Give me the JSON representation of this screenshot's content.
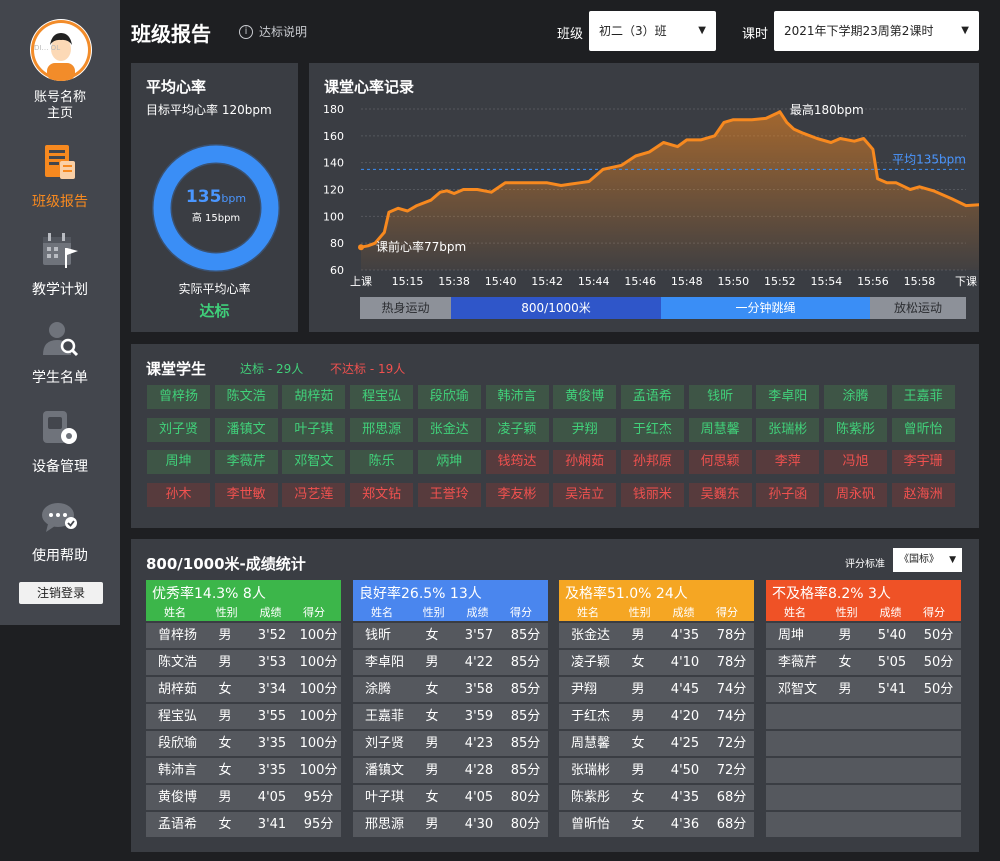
{
  "sidebar": {
    "account_line1": "账号名称",
    "account_line2": "主页",
    "avatar_text": "DI… OL",
    "items": [
      {
        "label": "班级报告",
        "icon": "report-icon",
        "active": true
      },
      {
        "label": "教学计划",
        "icon": "calendar-flag-icon",
        "active": false
      },
      {
        "label": "学生名单",
        "icon": "user-search-icon",
        "active": false
      },
      {
        "label": "设备管理",
        "icon": "device-gear-icon",
        "active": false
      },
      {
        "label": "使用帮助",
        "icon": "chat-help-icon",
        "active": false
      }
    ],
    "logout": "注销登录"
  },
  "header": {
    "title": "班级报告",
    "help_label": "达标说明",
    "class_label": "班级",
    "class_value": "初二（3）班",
    "lesson_label": "课时",
    "lesson_value": "2021年下学期23周第2课时"
  },
  "avg_panel": {
    "title": "平均心率",
    "target_label": "目标平均心率",
    "target_value": "120bpm",
    "value": "135",
    "unit": "bpm",
    "sub": "高 15bpm",
    "actual_label": "实际平均心率",
    "status": "达标",
    "ring_color": "#3a8ef6",
    "status_color": "#3fd07a"
  },
  "chart_panel": {
    "title": "课堂心率记录",
    "max_label": "最高180bpm",
    "avg_label": "平均135bpm",
    "start_label": "课前心率77bpm",
    "phases": [
      {
        "label": "热身运动",
        "bg": "#8d9199",
        "color": "#2b2d31"
      },
      {
        "label": "800/1000米",
        "bg": "#2f56c9",
        "color": "#ffffff"
      },
      {
        "label": "一分钟跳绳",
        "bg": "#3a8ef6",
        "color": "#ffffff"
      },
      {
        "label": "放松运动",
        "bg": "#8d9199",
        "color": "#2b2d31"
      }
    ]
  },
  "chart_data": {
    "type": "area",
    "title": "课堂心率记录",
    "ylim": [
      60,
      180
    ],
    "yticks": [
      60,
      80,
      100,
      120,
      140,
      160,
      180
    ],
    "xticks": [
      "上课",
      "15:15",
      "15:38",
      "15:40",
      "15:42",
      "15:44",
      "15:46",
      "15:48",
      "15:50",
      "15:52",
      "15:54",
      "15:56",
      "15:58",
      "下课"
    ],
    "average": 135,
    "max": 180,
    "start": 77,
    "line_color": "#f7891f",
    "avg_color": "#3a8ef6",
    "series": [
      {
        "values": [
          [
            0,
            77
          ],
          [
            0.15,
            78
          ],
          [
            0.3,
            80
          ],
          [
            0.5,
            88
          ],
          [
            0.6,
            103
          ],
          [
            0.8,
            106
          ],
          [
            1.0,
            104
          ],
          [
            1.2,
            108
          ],
          [
            1.5,
            112
          ],
          [
            1.7,
            118
          ],
          [
            1.85,
            119
          ],
          [
            2.0,
            117
          ],
          [
            2.2,
            120
          ],
          [
            2.5,
            120
          ],
          [
            2.8,
            118
          ],
          [
            3.1,
            125
          ],
          [
            3.5,
            125
          ],
          [
            4.0,
            125
          ],
          [
            4.3,
            123
          ],
          [
            4.5,
            124
          ],
          [
            4.7,
            125
          ],
          [
            4.9,
            126
          ],
          [
            5.2,
            135
          ],
          [
            5.6,
            138
          ],
          [
            5.9,
            145
          ],
          [
            6.2,
            148
          ],
          [
            6.5,
            155
          ],
          [
            6.8,
            152
          ],
          [
            7.0,
            157
          ],
          [
            7.3,
            157
          ],
          [
            7.6,
            160
          ],
          [
            7.8,
            170
          ],
          [
            8.0,
            172
          ],
          [
            8.4,
            172
          ],
          [
            8.7,
            173
          ],
          [
            8.95,
            177
          ],
          [
            9.0,
            178
          ],
          [
            9.15,
            170
          ],
          [
            9.3,
            165
          ],
          [
            9.5,
            162
          ],
          [
            9.8,
            158
          ],
          [
            10.1,
            155
          ],
          [
            10.3,
            158
          ],
          [
            10.6,
            156
          ],
          [
            10.8,
            158
          ],
          [
            11.0,
            150
          ],
          [
            11.1,
            128
          ],
          [
            11.3,
            125
          ],
          [
            11.5,
            125
          ],
          [
            11.8,
            120
          ],
          [
            12.0,
            122
          ],
          [
            12.3,
            119
          ],
          [
            12.7,
            113
          ],
          [
            13.0,
            108
          ],
          [
            13.4,
            109
          ],
          [
            13.7,
            110
          ],
          [
            14.0,
            113
          ],
          [
            14.4,
            118
          ],
          [
            14.8,
            120
          ],
          [
            15.1,
            120
          ],
          [
            15.3,
            118
          ]
        ]
      }
    ]
  },
  "students": {
    "title": "课堂学生",
    "pass_label": "达标 - 29人",
    "fail_label": "不达标 - 19人",
    "pass": [
      "曾梓扬",
      "陈文浩",
      "胡梓茹",
      "程宝弘",
      "段欣瑜",
      "韩沛言",
      "黄俊博",
      "孟语希",
      "钱昕",
      "李卓阳",
      "涂腾",
      "王嘉菲",
      "刘子贤",
      "潘镇文",
      "叶子琪",
      "邢思源",
      "张金达",
      "凌子颖",
      "尹翔",
      "于红杰",
      "周慧馨",
      "张瑞彬",
      "陈紫彤",
      "曾昕怡",
      "周坤",
      "李薇芹",
      "邓智文",
      "陈乐",
      "炳坤"
    ],
    "fail": [
      "钱筠达",
      "孙娴茹",
      "孙邦原",
      "何思颖",
      "李萍",
      "冯旭",
      "李宇珊",
      "孙木",
      "李世敏",
      "冯艺莲",
      "郑文钻",
      "王誉玲",
      "李友彬",
      "吴洁立",
      "钱丽米",
      "吴巍东",
      "孙子函",
      "周永矾",
      "赵海洲"
    ]
  },
  "grades": {
    "title": "800/1000米-成绩统计",
    "standard_label": "评分标准",
    "standard_value": "《国标》",
    "col_name": "姓名",
    "col_gender": "性别",
    "col_score": "成绩",
    "col_points": "得分",
    "cards": [
      {
        "title": "优秀率14.3%  8人",
        "color": "#3cb64a",
        "rows": [
          [
            "曾梓扬",
            "男",
            "3'52",
            "100分"
          ],
          [
            "陈文浩",
            "男",
            "3'53",
            "100分"
          ],
          [
            "胡梓茹",
            "女",
            "3'34",
            "100分"
          ],
          [
            "程宝弘",
            "男",
            "3'55",
            "100分"
          ],
          [
            "段欣瑜",
            "女",
            "3'35",
            "100分"
          ],
          [
            "韩沛言",
            "女",
            "3'35",
            "100分"
          ],
          [
            "黄俊博",
            "男",
            "4'05",
            "95分"
          ],
          [
            "孟语希",
            "女",
            "3'41",
            "95分"
          ]
        ]
      },
      {
        "title": "良好率26.5%  13人",
        "color": "#4a86ee",
        "rows": [
          [
            "钱昕",
            "女",
            "3'57",
            "85分"
          ],
          [
            "李卓阳",
            "男",
            "4'22",
            "85分"
          ],
          [
            "涂腾",
            "女",
            "3'58",
            "85分"
          ],
          [
            "王嘉菲",
            "女",
            "3'59",
            "85分"
          ],
          [
            "刘子贤",
            "男",
            "4'23",
            "85分"
          ],
          [
            "潘镇文",
            "男",
            "4'28",
            "85分"
          ],
          [
            "叶子琪",
            "女",
            "4'05",
            "80分"
          ],
          [
            "邢思源",
            "男",
            "4'30",
            "80分"
          ]
        ]
      },
      {
        "title": "及格率51.0%  24人",
        "color": "#f5a623",
        "rows": [
          [
            "张金达",
            "男",
            "4'35",
            "78分"
          ],
          [
            "凌子颖",
            "女",
            "4'10",
            "78分"
          ],
          [
            "尹翔",
            "男",
            "4'45",
            "74分"
          ],
          [
            "于红杰",
            "男",
            "4'20",
            "74分"
          ],
          [
            "周慧馨",
            "女",
            "4'25",
            "72分"
          ],
          [
            "张瑞彬",
            "男",
            "4'50",
            "72分"
          ],
          [
            "陈紫彤",
            "女",
            "4'35",
            "68分"
          ],
          [
            "曾昕怡",
            "女",
            "4'36",
            "68分"
          ]
        ]
      },
      {
        "title": "不及格率8.2%  3人",
        "color": "#ef5226",
        "rows": [
          [
            "周坤",
            "男",
            "5'40",
            "50分"
          ],
          [
            "李薇芹",
            "女",
            "5'05",
            "50分"
          ],
          [
            "邓智文",
            "男",
            "5'41",
            "50分"
          ],
          [
            "",
            "",
            "",
            ""
          ],
          [
            "",
            "",
            "",
            ""
          ],
          [
            "",
            "",
            "",
            ""
          ],
          [
            "",
            "",
            "",
            ""
          ],
          [
            "",
            "",
            "",
            ""
          ]
        ]
      }
    ]
  }
}
